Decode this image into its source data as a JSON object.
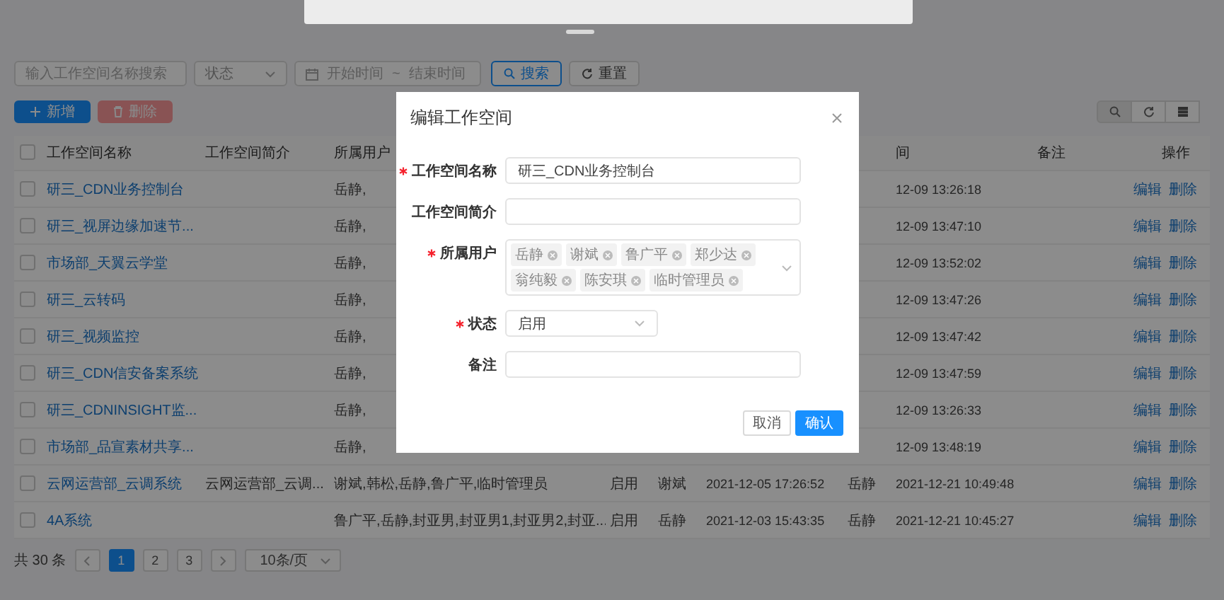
{
  "toolbar": {
    "search": {
      "placeholder": "输入工作空间名称搜索"
    },
    "status_select": {
      "placeholder": "状态"
    },
    "date_range": {
      "start_placeholder": "开始时间",
      "separator": "~",
      "end_placeholder": "结束时间"
    },
    "buttons": [
      {
        "label": "搜索",
        "kind": "primary"
      },
      {
        "label": "重置",
        "kind": "default"
      }
    ]
  },
  "actions": [
    {
      "label": "新增",
      "kind": "primary",
      "disabled": false
    },
    {
      "label": "删除",
      "kind": "danger",
      "disabled": true
    }
  ],
  "table": {
    "header_checked": false,
    "headers": {
      "name": "工作空间名称",
      "intro": "工作空间简介",
      "users": "所属用户",
      "updated": "间",
      "remark": "备注",
      "actions": "操作"
    },
    "rows": [
      {
        "checked": false,
        "name": "研三_CDN业务控制台",
        "users": "岳静,",
        "updated": "12-09 13:26:18",
        "actions": [
          "编辑",
          "删除"
        ]
      },
      {
        "checked": false,
        "name": "研三_视屏边缘加速节...",
        "users": "岳静,",
        "updated": "12-09 13:47:10",
        "actions": [
          "编辑",
          "删除"
        ]
      },
      {
        "checked": false,
        "name": "市场部_天翼云学堂",
        "users": "岳静,",
        "updated": "12-09 13:52:02",
        "actions": [
          "编辑",
          "删除"
        ]
      },
      {
        "checked": false,
        "name": "研三_云转码",
        "users": "岳静,",
        "updated": "12-09 13:47:26",
        "actions": [
          "编辑",
          "删除"
        ]
      },
      {
        "checked": false,
        "name": "研三_视频监控",
        "users": "岳静,",
        "updated": "12-09 13:47:42",
        "actions": [
          "编辑",
          "删除"
        ]
      },
      {
        "checked": false,
        "name": "研三_CDN信安备案系统",
        "users": "岳静,",
        "updated": "12-09 13:47:59",
        "actions": [
          "编辑",
          "删除"
        ]
      },
      {
        "checked": false,
        "name": "研三_CDNINSIGHT监...",
        "users": "岳静,",
        "updated": "12-09 13:26:33",
        "actions": [
          "编辑",
          "删除"
        ]
      },
      {
        "checked": false,
        "name": "市场部_品宣素材共享...",
        "users": "岳静,",
        "updated": "12-09 13:48:19",
        "actions": [
          "编辑",
          "删除"
        ]
      },
      {
        "checked": false,
        "name": "云网运营部_云调系统",
        "intro": "云网运营部_云调...",
        "users": "谢斌,韩松,岳静,鲁广平,临时管理员",
        "status": "启用",
        "creator": "谢斌",
        "created": "2021-12-05 17:26:52",
        "updater": "岳静",
        "updated": "2021-12-21 10:49:48",
        "actions": [
          "编辑",
          "删除"
        ]
      },
      {
        "checked": false,
        "name": "4A系统",
        "users": "鲁广平,岳静,封亚男,封亚男1,封亚男2,封亚...",
        "status": "启用",
        "creator": "岳静",
        "created": "2021-12-03 15:43:35",
        "updater": "岳静",
        "updated": "2021-12-21 10:45:27",
        "actions": [
          "编辑",
          "删除"
        ]
      }
    ]
  },
  "pagination": {
    "total": "共 30 条",
    "pages": [
      {
        "label": "1",
        "selected": true
      },
      {
        "label": "2",
        "selected": false
      },
      {
        "label": "3",
        "selected": false
      }
    ],
    "page_size": "10条/页"
  },
  "modal": {
    "title": "编辑工作空间",
    "fields": [
      {
        "label": "工作空间名称",
        "required": true,
        "kind": "input",
        "value": "研三_CDN业务控制台"
      },
      {
        "label": "工作空间简介",
        "required": false,
        "kind": "input"
      },
      {
        "label": "所属用户",
        "required": true,
        "kind": "tags",
        "tags": [
          "岳静",
          "谢斌",
          "鲁广平",
          "郑少达",
          "翁纯毅",
          "陈安琪",
          "临时管理员"
        ]
      },
      {
        "label": "状态",
        "required": true,
        "kind": "select",
        "value": "启用"
      },
      {
        "label": "备注",
        "required": false,
        "kind": "input"
      }
    ],
    "buttons": [
      {
        "label": "取消",
        "kind": "default"
      },
      {
        "label": "确认",
        "kind": "primary"
      }
    ]
  }
}
